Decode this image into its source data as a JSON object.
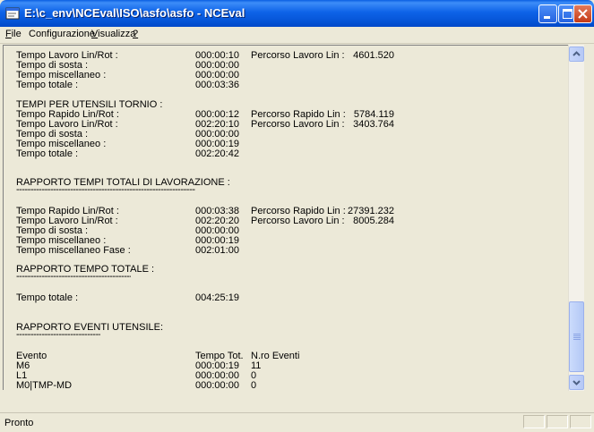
{
  "window": {
    "title": "E:\\c_env\\NCEval\\ISO\\asfo\\asfo - NCEval"
  },
  "menu": [
    {
      "label": "File",
      "mnemonic": "F"
    },
    {
      "label": "Configurazione",
      "mnemonic": ""
    },
    {
      "label": "Visualizza",
      "mnemonic": "V"
    },
    {
      "label": "?",
      "mnemonic": "?"
    }
  ],
  "report": {
    "s1": {
      "r1": {
        "label": "Tempo Lavoro Lin/Rot :",
        "time": "000:00:10",
        "plabel": "Percorso Lavoro Lin :",
        "pval": "4601.520"
      },
      "r2": {
        "label": "Tempo di sosta :",
        "time": "000:00:00"
      },
      "r3": {
        "label": "Tempo miscellaneo :",
        "time": "000:00:00"
      },
      "r4": {
        "label": "Tempo totale :",
        "time": "000:03:36"
      }
    },
    "s2": {
      "heading": "TEMPI PER UTENSILI TORNIO :",
      "r1": {
        "label": "Tempo Rapido Lin/Rot :",
        "time": "000:00:12",
        "plabel": "Percorso Rapido Lin :",
        "pval": "5784.119"
      },
      "r2": {
        "label": "Tempo Lavoro Lin/Rot :",
        "time": "002:20:10",
        "plabel": "Percorso Lavoro Lin :",
        "pval": "3403.764"
      },
      "r3": {
        "label": "Tempo di sosta :",
        "time": "000:00:00"
      },
      "r4": {
        "label": "Tempo miscellaneo :",
        "time": "000:00:19"
      },
      "r5": {
        "label": "Tempo totale :",
        "time": "002:20:42"
      }
    },
    "s3": {
      "heading": "RAPPORTO TEMPI TOTALI DI LAVORAZIONE :",
      "underline": "--------------------------------------------------------------------",
      "r1": {
        "label": "Tempo Rapido Lin/Rot :",
        "time": "000:03:38",
        "plabel": "Percorso Rapido Lin :",
        "pval": "27391.232"
      },
      "r2": {
        "label": "Tempo Lavoro Lin/Rot :",
        "time": "002:20:20",
        "plabel": "Percorso Lavoro Lin :",
        "pval": "8005.284"
      },
      "r3": {
        "label": "Tempo di sosta :",
        "time": "000:00:00"
      },
      "r4": {
        "label": "Tempo miscellaneo :",
        "time": "000:00:19"
      },
      "r5": {
        "label": "Tempo miscellaneo Fase :",
        "time": "002:01:00"
      }
    },
    "s4": {
      "heading": "RAPPORTO TEMPO TOTALE :",
      "underline": "------------------------------------------",
      "r1": {
        "label": "Tempo totale :",
        "time": "004:25:19"
      }
    },
    "s5": {
      "heading": "RAPPORTO EVENTI UTENSILE:",
      "underline": "-----------------------------------",
      "header": {
        "col1": "Evento",
        "col2": "Tempo Tot.",
        "col3": "N.ro Eventi"
      },
      "rows": [
        {
          "evento": "M6",
          "tempo": "000:00:19",
          "n": "11"
        },
        {
          "evento": "L1",
          "tempo": "000:00:00",
          "n": "0"
        },
        {
          "evento": "M0|TMP-MD",
          "tempo": "000:00:00",
          "n": "0"
        }
      ]
    }
  },
  "statusbar": {
    "text": "Pronto"
  },
  "colors": {
    "titlebar": "#0A5FE3",
    "close_button": "#C43A16",
    "window_bg": "#ECE9D8"
  },
  "icons": [
    "app-icon",
    "minimize-icon",
    "maximize-icon",
    "close-icon",
    "scroll-up-arrow-icon",
    "scroll-down-arrow-icon"
  ]
}
